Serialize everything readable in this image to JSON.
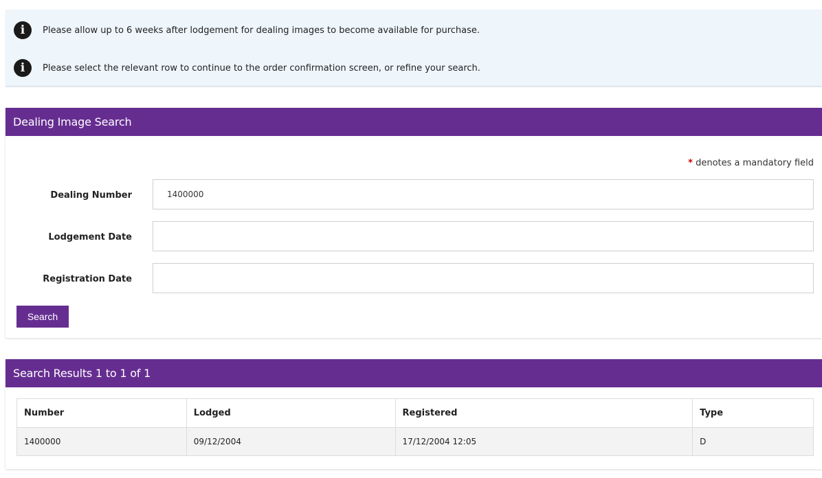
{
  "notices": [
    "Please allow up to 6 weeks after lodgement for dealing images to become available for purchase.",
    "Please select the relevant row to continue to the order confirmation screen, or refine your search."
  ],
  "search_panel": {
    "title": "Dealing Image Search",
    "mandatory_star": "*",
    "mandatory_note": "denotes a mandatory field",
    "fields": {
      "dealing_number": {
        "label": "Dealing Number",
        "value": "1400000",
        "placeholder": ""
      },
      "lodgement_date": {
        "label": "Lodgement Date",
        "value": "",
        "placeholder": ""
      },
      "registration_date": {
        "label": "Registration Date",
        "value": "",
        "placeholder": ""
      }
    },
    "search_button": "Search"
  },
  "results_panel": {
    "title": "Search Results 1 to 1 of 1",
    "columns": [
      "Number",
      "Lodged",
      "Registered",
      "Type"
    ],
    "rows": [
      [
        "1400000",
        "09/12/2004",
        "17/12/2004 12:05",
        "D"
      ]
    ]
  },
  "colors": {
    "brand_purple": "#662d91",
    "notice_background": "#eef5fb",
    "mandatory_star": "#cc0000"
  },
  "icons": {
    "notice": "info-icon"
  }
}
